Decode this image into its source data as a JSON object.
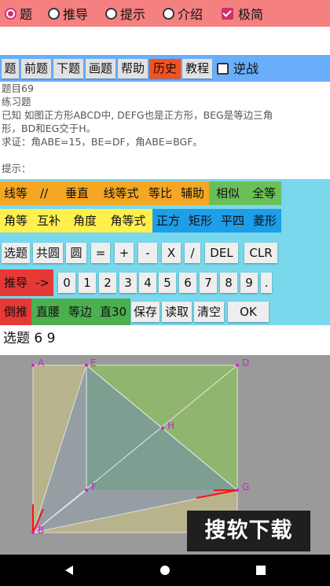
{
  "modes": [
    {
      "label": "题",
      "selected": true
    },
    {
      "label": "推导",
      "selected": false
    },
    {
      "label": "提示",
      "selected": false
    },
    {
      "label": "介绍",
      "selected": false
    }
  ],
  "minimal": {
    "label": "极简",
    "checked": true
  },
  "toolbar": {
    "buttons": [
      "题",
      "前题",
      "下题",
      "画题",
      "帮助",
      "历史",
      "教程"
    ],
    "reverse_label": "逆战",
    "reverse_checked": false
  },
  "problem": {
    "id": "题目69",
    "type": "练习题",
    "given_1": "已知 如图正方形ABCD中, DEFG也是正方形，BEG是等边三角",
    "given_2": "形，BD和EG交于H。",
    "prove": "求证：角ABE=15，BE=DF，角ABE=BGF。",
    "hint_label": "提示："
  },
  "keypad": {
    "row1": [
      "线等",
      "//",
      "垂直",
      "线等式",
      "等比",
      "辅助",
      "相似",
      "全等"
    ],
    "row2": [
      "角等",
      "互补",
      "角度",
      "角等式",
      "正方",
      "矩形",
      "平四",
      "菱形"
    ],
    "row3": [
      "选题",
      "共圆",
      "圆",
      "=",
      "+",
      "-",
      "X",
      "/",
      "DEL",
      "CLR"
    ],
    "row4": [
      "推导",
      "->",
      "0",
      "1",
      "2",
      "3",
      "4",
      "5",
      "6",
      "7",
      "8",
      "9",
      "."
    ],
    "row5": [
      "倒推",
      "直腰",
      "等边",
      "直30",
      "保存",
      "读取",
      "清空",
      "OK"
    ]
  },
  "status": "选题 6 9",
  "figure": {
    "points": [
      "A",
      "E",
      "D",
      "H",
      "F",
      "G",
      "B"
    ],
    "colors": {
      "point": "#cc22cc",
      "arrow": "#ff1111"
    }
  },
  "watermark": "搜软下载",
  "nav": [
    "back-icon",
    "home-icon",
    "recents-icon"
  ]
}
